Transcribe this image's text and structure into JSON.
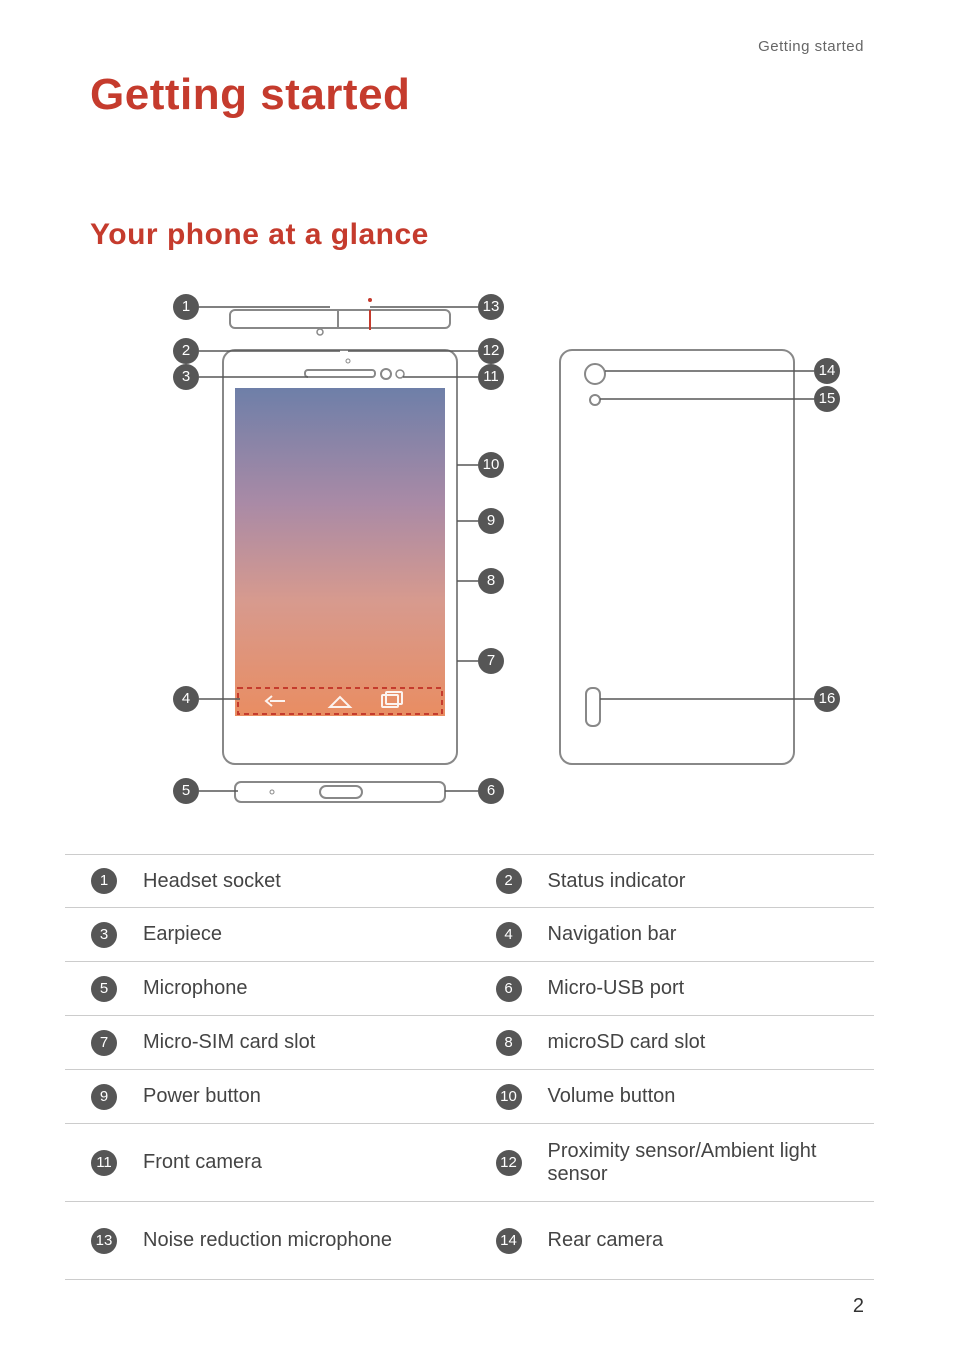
{
  "running_head": "Getting started",
  "title": "Getting started",
  "section_title": "Your phone at a glance",
  "page_number": "2",
  "callouts": {
    "1": "1",
    "2": "2",
    "3": "3",
    "4": "4",
    "5": "5",
    "6": "6",
    "7": "7",
    "8": "8",
    "9": "9",
    "10": "10",
    "11": "11",
    "12": "12",
    "13": "13",
    "14": "14",
    "15": "15",
    "16": "16"
  },
  "legend": [
    {
      "numA": "1",
      "labelA": "Headset socket",
      "numB": "2",
      "labelB": "Status indicator"
    },
    {
      "numA": "3",
      "labelA": "Earpiece",
      "numB": "4",
      "labelB": "Navigation bar"
    },
    {
      "numA": "5",
      "labelA": "Microphone",
      "numB": "6",
      "labelB": "Micro-USB port"
    },
    {
      "numA": "7",
      "labelA": "Micro-SIM card slot",
      "numB": "8",
      "labelB": "microSD card slot"
    },
    {
      "numA": "9",
      "labelA": "Power button",
      "numB": "10",
      "labelB": "Volume button"
    },
    {
      "numA": "11",
      "labelA": "Front camera",
      "numB": "12",
      "labelB": "Proximity sensor/Ambient light sensor",
      "tall": true
    },
    {
      "numA": "13",
      "labelA": "Noise reduction microphone",
      "numB": "14",
      "labelB": "Rear camera",
      "tall": true
    }
  ]
}
